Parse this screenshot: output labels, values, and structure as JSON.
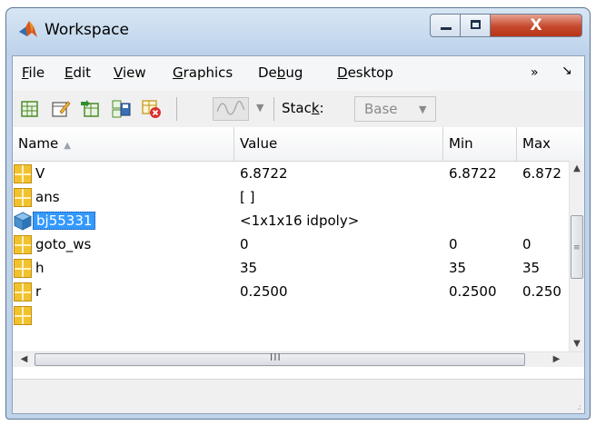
{
  "window": {
    "title": "Workspace",
    "controls": {
      "minimize": "minimize",
      "maximize": "maximize",
      "close": "X"
    }
  },
  "menu": {
    "items": [
      {
        "label": "File",
        "hotkey": "F",
        "rest": "ile"
      },
      {
        "label": "Edit",
        "hotkey": "E",
        "rest": "dit"
      },
      {
        "label": "View",
        "hotkey": "V",
        "rest": "iew"
      },
      {
        "label": "Graphics",
        "hotkey": "G",
        "rest": "raphics"
      },
      {
        "label": "Debug",
        "pre": "De",
        "hotkey": "b",
        "rest": "ug"
      },
      {
        "label": "Desktop",
        "hotkey": "D",
        "rest": "esktop"
      }
    ],
    "overflow": "»",
    "undock": "↘"
  },
  "toolbar": {
    "icons": [
      "new-variable-icon",
      "open-variable-icon",
      "import-data-icon",
      "save-workspace-icon",
      "delete-variable-icon",
      "plot-selection-icon"
    ],
    "stack_label_pre": "Stac",
    "stack_label_hotkey": "k",
    "stack_label_post": ":",
    "stack_value": "Base"
  },
  "table": {
    "columns": [
      "Name",
      "Value",
      "Min",
      "Max"
    ],
    "sort_indicator": "▲",
    "rows": [
      {
        "name": "V",
        "value": "6.8722",
        "min": "6.8722",
        "max": "6.872",
        "icon": "matrix-icon"
      },
      {
        "name": "ans",
        "value": "[ ]",
        "min": "",
        "max": "",
        "icon": "matrix-icon"
      },
      {
        "name": "bj55331",
        "value": "<1x1x16 idpoly>",
        "min": "",
        "max": "",
        "icon": "object-icon",
        "selected": true
      },
      {
        "name": "goto_ws",
        "value": "0",
        "min": "0",
        "max": "0",
        "icon": "matrix-icon"
      },
      {
        "name": "h",
        "value": "35",
        "min": "35",
        "max": "35",
        "icon": "matrix-icon"
      },
      {
        "name": "r",
        "value": "0.2500",
        "min": "0.2500",
        "max": "0.250",
        "icon": "matrix-icon"
      }
    ]
  },
  "scrollbar": {
    "up": "▲",
    "down": "▼",
    "left": "◀",
    "right": "▶",
    "grip_h": "III",
    "grip_v": "≡"
  },
  "statusbar": {
    "grip": ".:"
  },
  "colors": {
    "selection": "#3399ff",
    "matrix_icon": "#f2c12e",
    "close_button": "#c6492e",
    "matlab_logo": "#d55a1d"
  }
}
